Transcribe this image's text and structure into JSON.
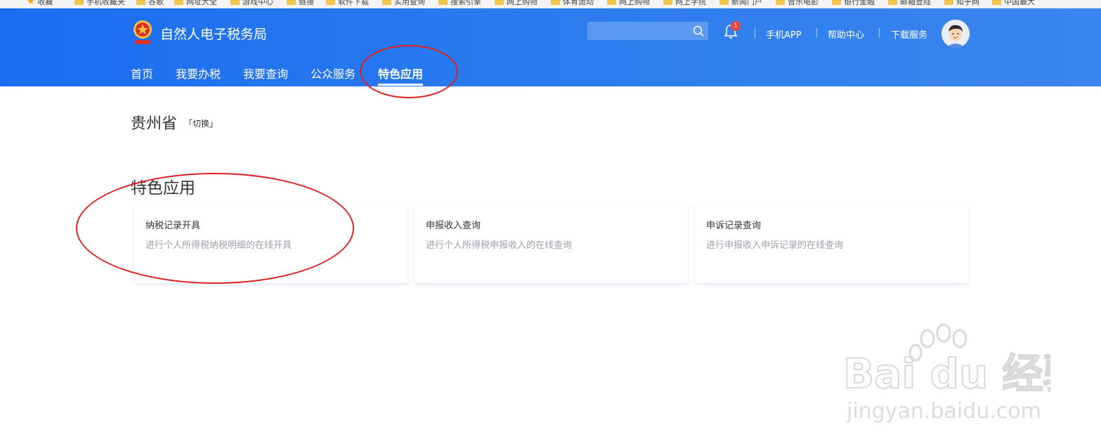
{
  "bookmarks": [
    "收藏",
    "手机收藏夹",
    "谷歌",
    "网址大全",
    "游戏中心",
    "链接",
    "软件下载",
    "实用查询",
    "搜索引擎",
    "网上购物",
    "体育运动",
    "网上购物",
    "网上学院",
    "新闻门户",
    "音乐电影",
    "银行金融",
    "邮箱登陆",
    "知乎网",
    "中国最大"
  ],
  "header": {
    "site_title": "自然人电子税务局",
    "search_placeholder": "",
    "notification_count": "1",
    "links": [
      "手机APP",
      "帮助中心",
      "下载服务"
    ]
  },
  "nav": {
    "items": [
      "首页",
      "我要办税",
      "我要查询",
      "公众服务",
      "特色应用"
    ],
    "active": "特色应用"
  },
  "province": {
    "name": "贵州省",
    "switch_label": "「切换」"
  },
  "section": {
    "title": "特色应用",
    "cards": [
      {
        "title": "纳税记录开具",
        "desc": "进行个人所得税纳税明细的在线开具"
      },
      {
        "title": "申报收入查询",
        "desc": "进行个人所得税申报收入的在线查询"
      },
      {
        "title": "申诉记录查询",
        "desc": "进行申报收入申诉记录的在线查询"
      }
    ]
  },
  "watermark": {
    "brand": "Bai du 经验",
    "url": "jingyan.baidu.com"
  },
  "colors": {
    "header_blue": "#1a6df0",
    "annotation_red": "#e02020",
    "badge_red": "#f0443a"
  }
}
